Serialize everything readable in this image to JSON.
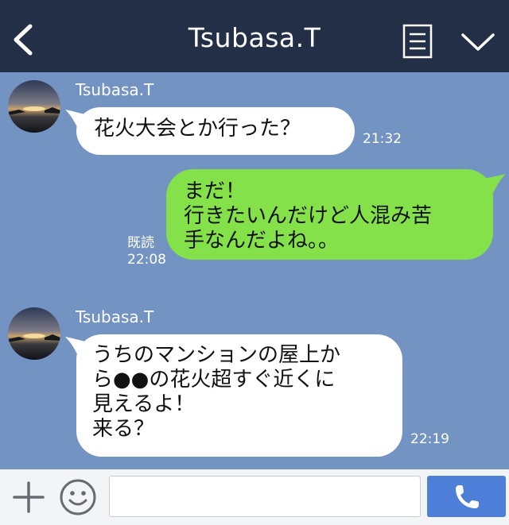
{
  "header": {
    "title": "Tsubasa.T",
    "back_icon": "chevron-left-icon",
    "notes_icon": "notes-icon",
    "collapse_icon": "chevron-down-icon"
  },
  "messages": [
    {
      "sender": "Tsubasa.T",
      "direction": "incoming",
      "text": "花火大会とか行った？",
      "time": "21:32"
    },
    {
      "direction": "outgoing",
      "text": "まだ！\n行きたいんだけど人混み苦\n手なんだよね。。",
      "read_label": "既読",
      "time": "22:08"
    },
    {
      "sender": "Tsubasa.T",
      "direction": "incoming",
      "text": "うちのマンションの屋上か\nら●●の花火超すぐ近くに\n見えるよ！\n来る？",
      "time": "22:19"
    }
  ],
  "footer": {
    "plus_icon": "plus-icon",
    "emoji_icon": "smiley-icon",
    "input_value": "",
    "call_icon": "phone-icon"
  },
  "colors": {
    "header_bg": "#232e47",
    "chat_bg": "#7393c2",
    "outgoing_bubble": "#85e14a",
    "incoming_bubble": "#ffffff",
    "call_button": "#4d7ed8"
  }
}
